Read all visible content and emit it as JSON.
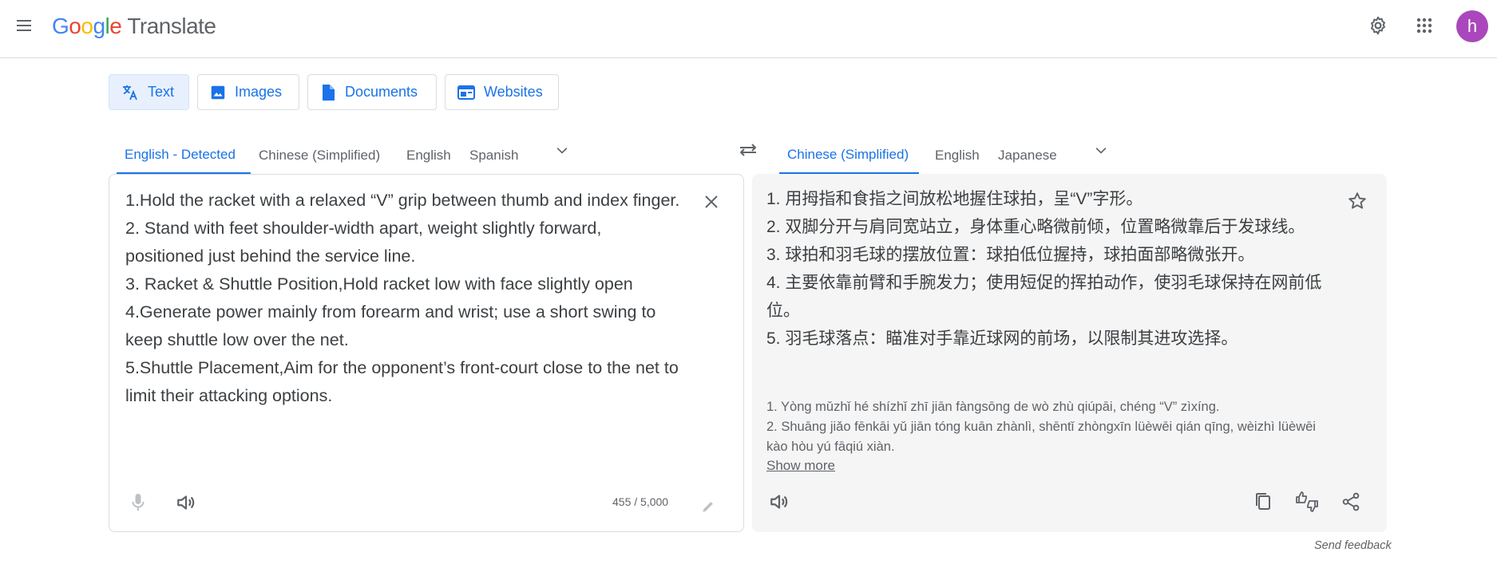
{
  "header": {
    "logo_letters": [
      "G",
      "o",
      "o",
      "g",
      "l",
      "e"
    ],
    "product_name": "Translate",
    "avatar_initial": "h",
    "icons": [
      "menu-icon",
      "settings-icon",
      "apps-grid-icon"
    ]
  },
  "mode_tabs": [
    {
      "label": "Text",
      "icon": "translate-icon",
      "active": true
    },
    {
      "label": "Images",
      "icon": "image-icon",
      "active": false
    },
    {
      "label": "Documents",
      "icon": "document-icon",
      "active": false
    },
    {
      "label": "Websites",
      "icon": "website-icon",
      "active": false
    }
  ],
  "source_langs": [
    {
      "label": "English - Detected",
      "active": true
    },
    {
      "label": "Chinese (Simplified)",
      "active": false
    },
    {
      "label": "English",
      "active": false
    },
    {
      "label": "Spanish",
      "active": false
    }
  ],
  "target_langs": [
    {
      "label": "Chinese (Simplified)",
      "active": true
    },
    {
      "label": "English",
      "active": false
    },
    {
      "label": "Japanese",
      "active": false
    }
  ],
  "source": {
    "lines": [
      "1.Hold the racket with a relaxed “V” grip between thumb and index finger.",
      "2. Stand with feet shoulder-width apart, weight slightly forward, positioned just behind the service line.",
      "3. Racket & Shuttle Position,Hold racket low with face slightly open",
      "4.Generate power mainly from forearm and wrist; use a short swing to keep shuttle low over the net.",
      "5.Shuttle Placement,Aim for the opponent’s front-court close to the net to limit their attacking options."
    ],
    "char_count": "455 / 5,000"
  },
  "target": {
    "lines": [
      "1. 用拇指和食指之间放松地握住球拍，呈“V”字形。",
      "2. 双脚分开与肩同宽站立，身体重心略微前倾，位置略微靠后于发球线。",
      "3. 球拍和羽毛球的摆放位置：球拍低位握持，球拍面部略微张开。",
      "4. 主要依靠前臂和手腕发力；使用短促的挥拍动作，使羽毛球保持在网前低位。",
      "5. 羽毛球落点：瞄准对手靠近球网的前场，以限制其进攻选择。"
    ],
    "pinyin": [
      "1. Yòng mǔzhǐ hé shízhǐ zhī jiān fàngsōng de wò zhù qiúpāi, chéng “V” zìxíng.",
      "2. Shuāng jiǎo fēnkāi yǔ jiān tóng kuān zhànlì, shēntǐ zhòngxīn lüèwēi qián qīng, wèizhì lüèwēi kào hòu yú fāqiú xiàn."
    ],
    "show_more": "Show more"
  },
  "footer": {
    "send_feedback": "Send feedback"
  },
  "colors": {
    "accent": "#1a73e8",
    "active_tab_bg": "#e8f0fe",
    "avatar": "#ab47bc",
    "target_bg": "#f5f5f5"
  }
}
